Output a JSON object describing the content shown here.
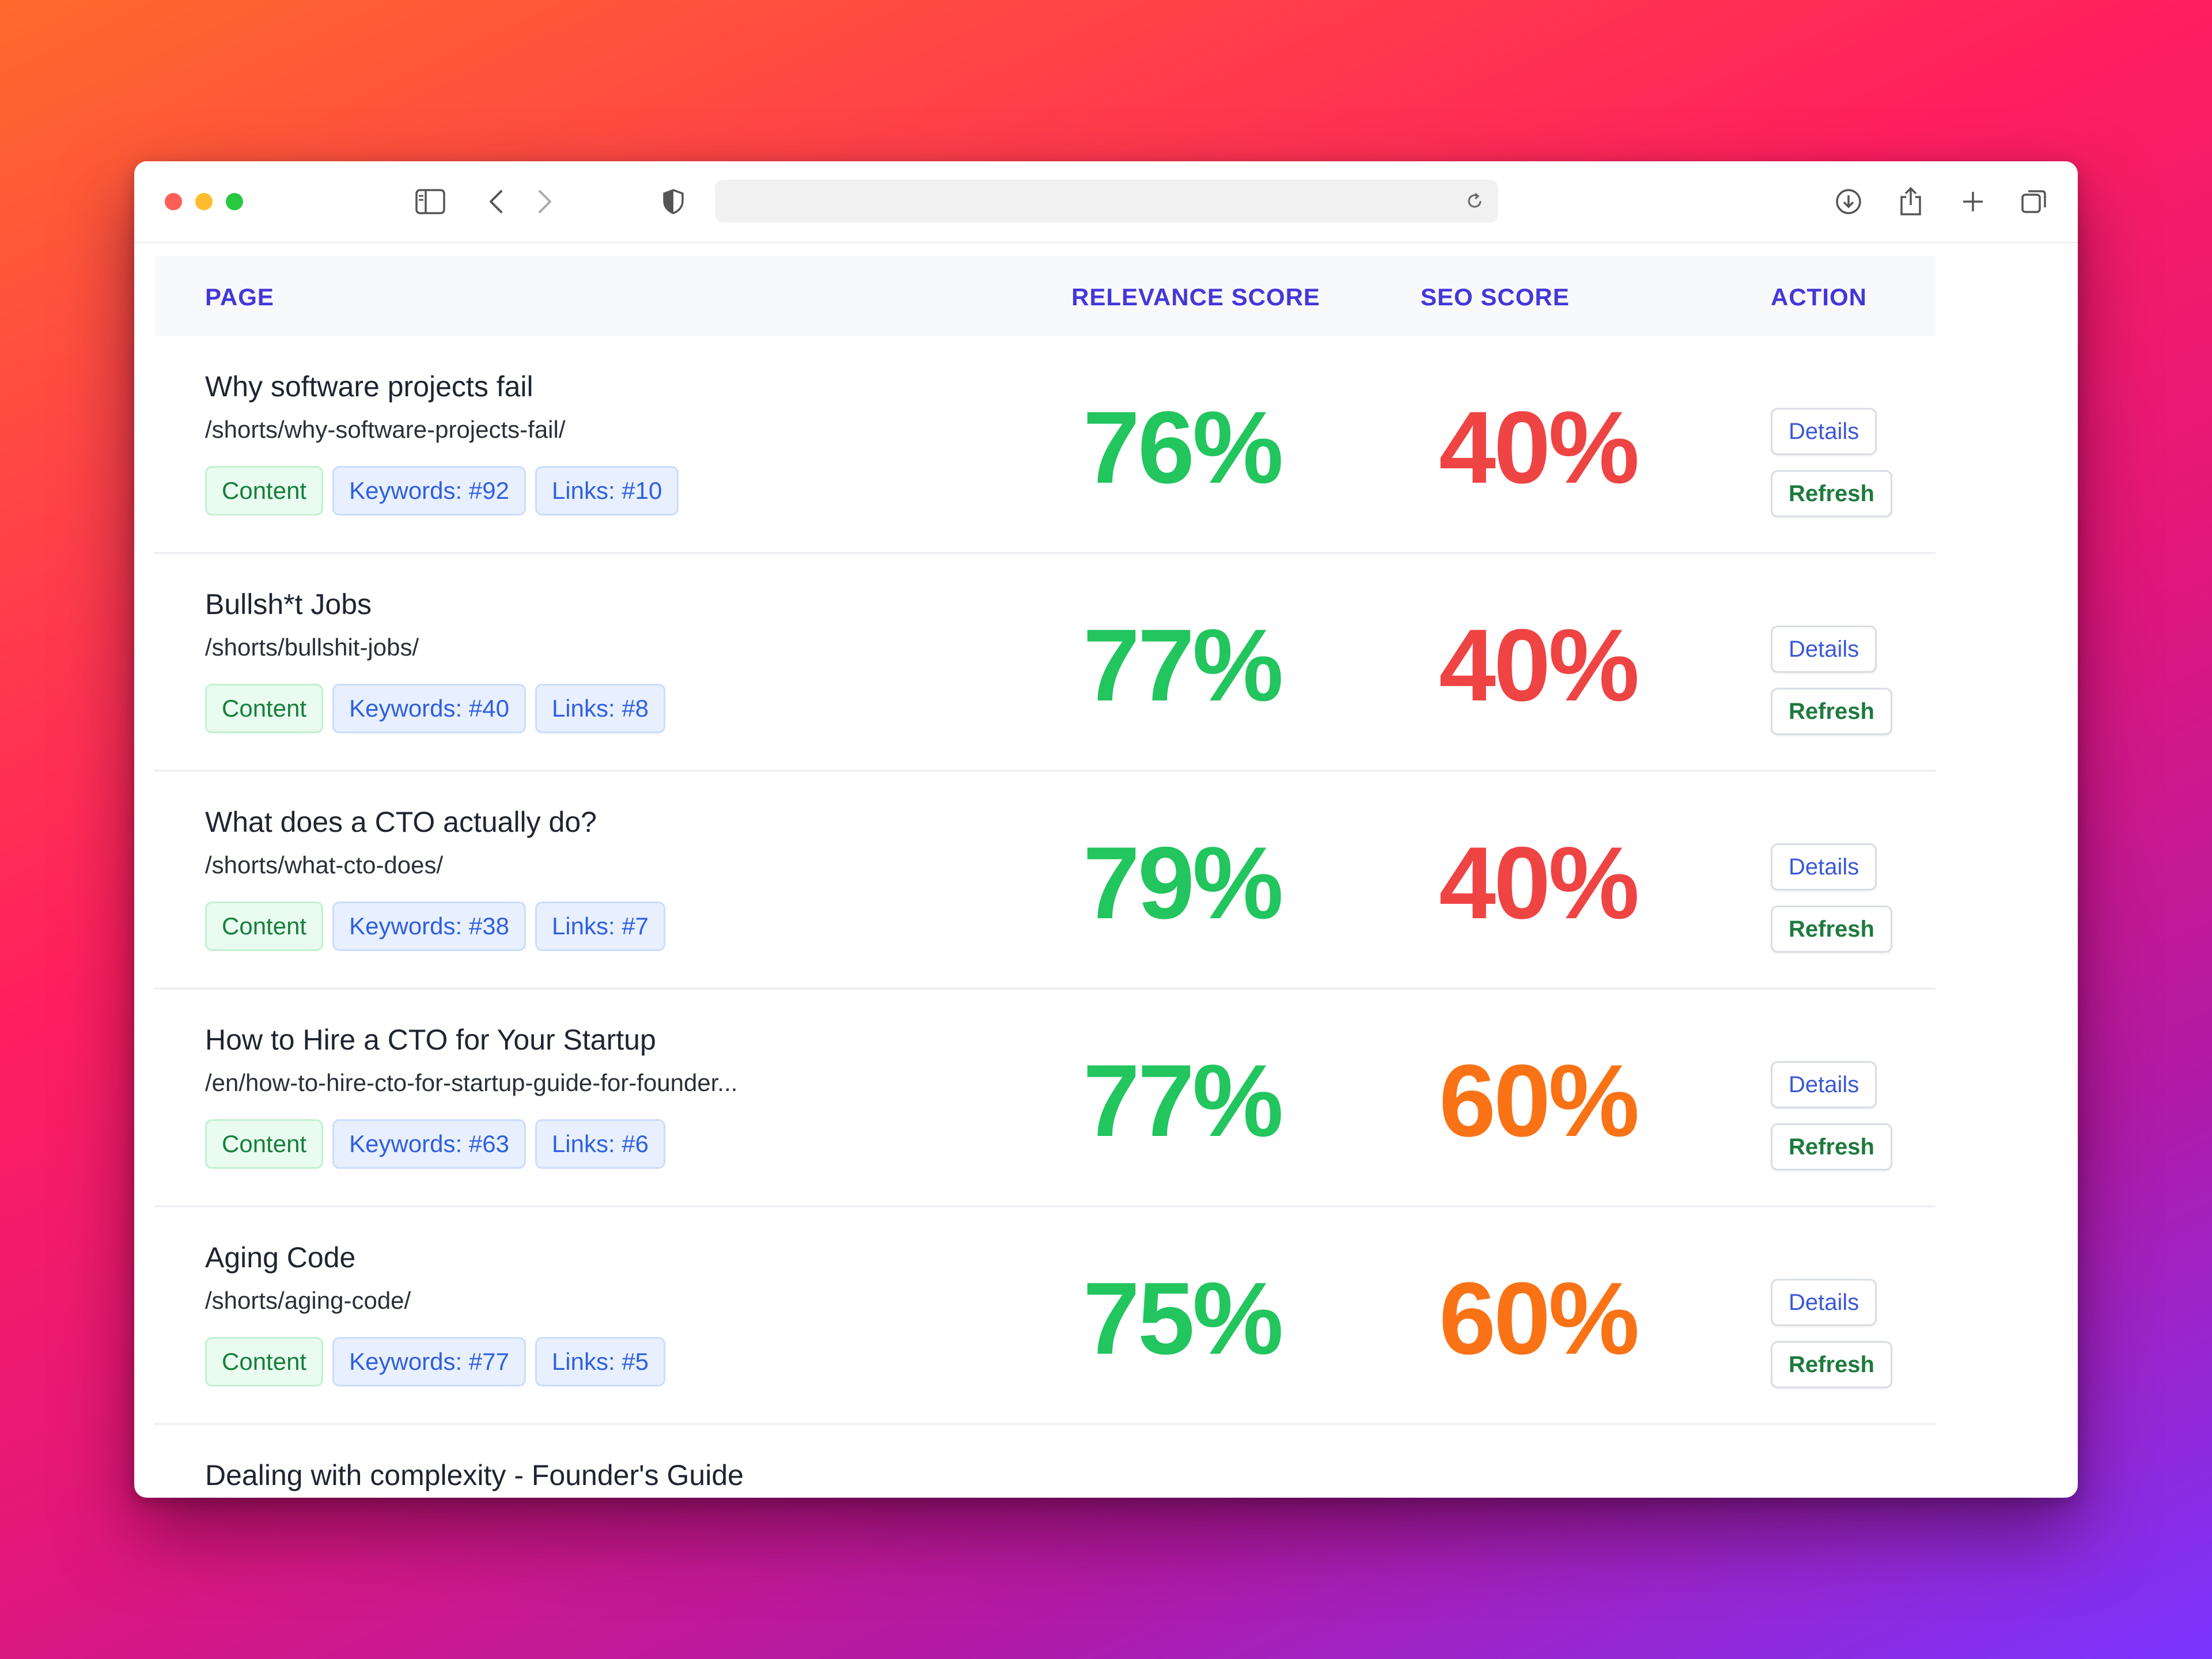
{
  "table": {
    "headers": {
      "page": "PAGE",
      "relevance": "RELEVANCE SCORE",
      "seo": "SEO SCORE",
      "action": "ACTION"
    },
    "rows": [
      {
        "title": "Why software projects fail",
        "path": "/shorts/why-software-projects-fail/",
        "tag_content": "Content",
        "tag_keywords": "Keywords: #92",
        "tag_links": "Links: #10",
        "relevance": "76%",
        "seo": "40%",
        "seo_status": "red",
        "details_label": "Details",
        "refresh_label": "Refresh"
      },
      {
        "title": "Bullsh*t Jobs",
        "path": "/shorts/bullshit-jobs/",
        "tag_content": "Content",
        "tag_keywords": "Keywords: #40",
        "tag_links": "Links: #8",
        "relevance": "77%",
        "seo": "40%",
        "seo_status": "red",
        "details_label": "Details",
        "refresh_label": "Refresh"
      },
      {
        "title": "What does a CTO actually do?",
        "path": "/shorts/what-cto-does/",
        "tag_content": "Content",
        "tag_keywords": "Keywords: #38",
        "tag_links": "Links: #7",
        "relevance": "79%",
        "seo": "40%",
        "seo_status": "red",
        "details_label": "Details",
        "refresh_label": "Refresh"
      },
      {
        "title": "How to Hire a CTO for Your Startup",
        "path": "/en/how-to-hire-cto-for-startup-guide-for-founder...",
        "tag_content": "Content",
        "tag_keywords": "Keywords: #63",
        "tag_links": "Links: #6",
        "relevance": "77%",
        "seo": "60%",
        "seo_status": "orange",
        "details_label": "Details",
        "refresh_label": "Refresh"
      },
      {
        "title": "Aging Code",
        "path": "/shorts/aging-code/",
        "tag_content": "Content",
        "tag_keywords": "Keywords: #77",
        "tag_links": "Links: #5",
        "relevance": "75%",
        "seo": "60%",
        "seo_status": "orange",
        "details_label": "Details",
        "refresh_label": "Refresh"
      },
      {
        "title": "Dealing with complexity - Founder's Guide",
        "path": "",
        "tag_content": "",
        "tag_keywords": "",
        "tag_links": "",
        "relevance": "",
        "seo": "",
        "seo_status": "orange",
        "details_label": "",
        "refresh_label": ""
      }
    ]
  },
  "colors": {
    "header_text": "#4437d8",
    "score_good": "#22c55e",
    "score_bad": "#ef4444",
    "score_mid": "#f97316"
  },
  "icons": {
    "sidebar": "sidebar-icon",
    "back": "chevron-left-icon",
    "forward": "chevron-right-icon",
    "privacy": "shield-icon",
    "reload": "reload-icon",
    "download": "download-icon",
    "share": "share-icon",
    "new_tab": "plus-icon",
    "tabs": "tabs-overview-icon"
  }
}
